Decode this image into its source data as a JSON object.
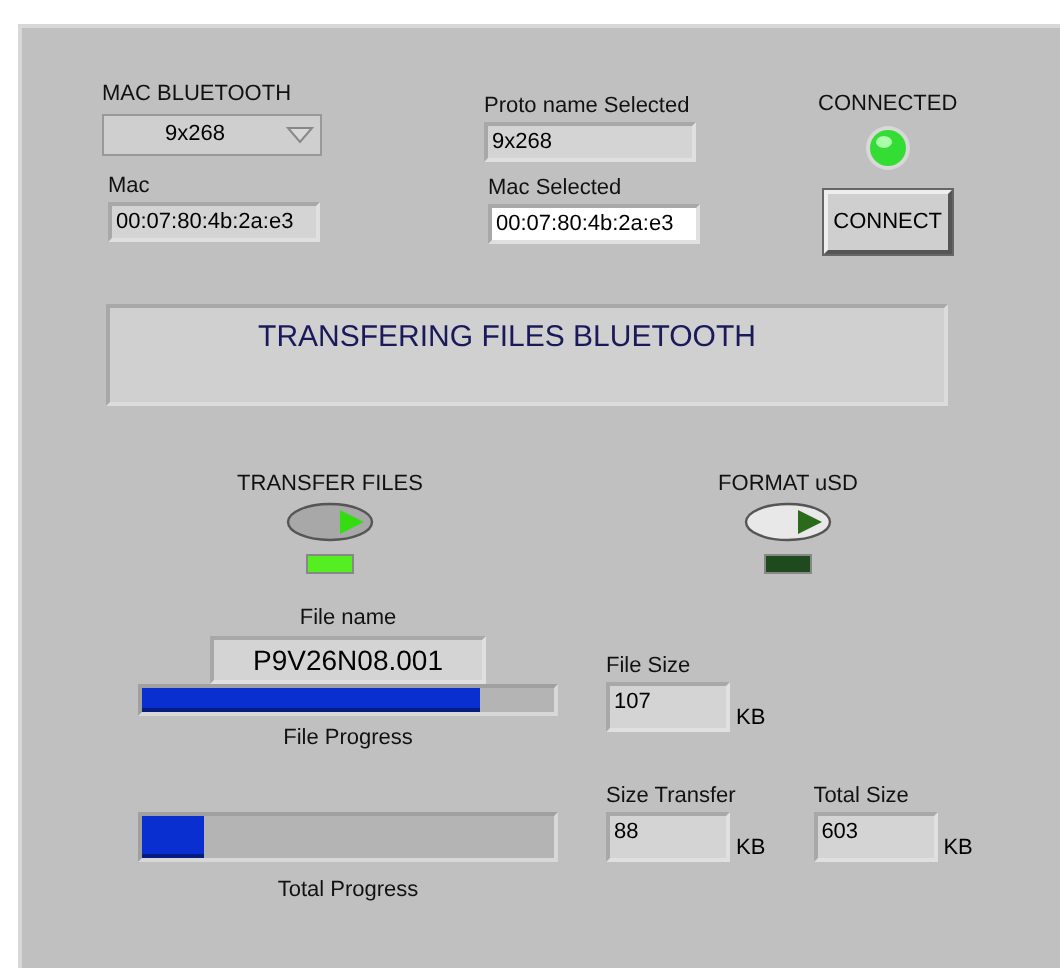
{
  "mac_bluetooth": {
    "label": "MAC BLUETOOTH",
    "value": "9x268"
  },
  "mac": {
    "label": "Mac",
    "value": "00:07:80:4b:2a:e3"
  },
  "proto_name_selected": {
    "label": "Proto name Selected",
    "value": "9x268"
  },
  "mac_selected": {
    "label": "Mac Selected",
    "value": "00:07:80:4b:2a:e3"
  },
  "connected": {
    "label": "CONNECTED",
    "on": true
  },
  "connect_button": "CONNECT",
  "status_banner": "TRANSFERING FILES BLUETOOTH",
  "switches": [
    {
      "label": "TRANSFER FILES",
      "on": true
    },
    {
      "label": "FORMAT uSD",
      "on": false
    }
  ],
  "file_name": {
    "label": "File name",
    "value": "P9V26N08.001"
  },
  "file_progress": {
    "label": "File Progress",
    "level": 0.82
  },
  "total_progress": {
    "label": "Total Progress",
    "level": 0.15
  },
  "file_size": {
    "label": "File Size",
    "value": "107",
    "unit": "KB"
  },
  "size_transfer": {
    "label": "Size Transfer",
    "value": "88",
    "unit": "KB"
  },
  "total_size": {
    "label": "Total Size",
    "value": "603",
    "unit": "KB"
  }
}
